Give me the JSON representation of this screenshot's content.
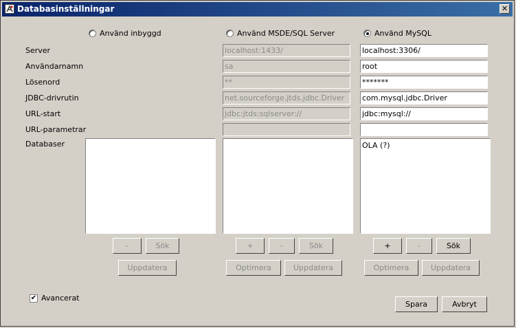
{
  "window": {
    "title": "Databasinställningar",
    "close_glyph": "✕"
  },
  "radios": [
    {
      "label": "Använd inbyggd",
      "checked": false
    },
    {
      "label": "Använd MSDE/SQL Server",
      "checked": false
    },
    {
      "label": "Använd MySQL",
      "checked": true
    }
  ],
  "labels": {
    "server": "Server",
    "user": "Användarnamn",
    "password": "Lösenord",
    "driver": "JDBC-drivrutin",
    "url_start": "URL-start",
    "url_params": "URL-parametrar",
    "databases": "Databaser"
  },
  "columns": {
    "builtin": {
      "databases": []
    },
    "mssql": {
      "server": "localhost:1433/",
      "user": "sa",
      "password": "**",
      "driver": "net.sourceforge.jtds.jdbc.Driver",
      "url_start": "jdbc:jtds:sqlserver://",
      "url_params": "",
      "databases": []
    },
    "mysql": {
      "server": "localhost:3306/",
      "user": "root",
      "password": "*******",
      "driver": "com.mysql.jdbc.Driver",
      "url_start": "jdbc:mysql://",
      "url_params": "",
      "databases": [
        "OLA (?)"
      ]
    }
  },
  "buttons": {
    "plus": "+",
    "minus": "-",
    "search": "Sök",
    "update": "Uppdatera",
    "optimize": "Optimera",
    "save": "Spara",
    "cancel": "Avbryt"
  },
  "advanced": {
    "label": "Avancerat",
    "checked": true,
    "check_glyph": "✔"
  }
}
